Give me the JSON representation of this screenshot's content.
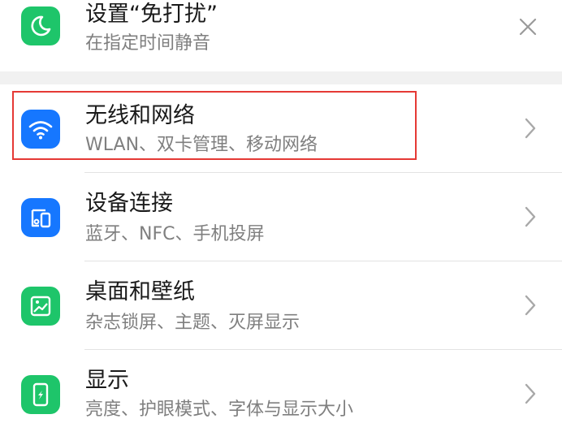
{
  "colors": {
    "wifi_icon_bg": "#1677ff",
    "device_icon_bg": "#1677ff",
    "green_icon_bg": "#1ec56a",
    "highlight_border": "#e53935"
  },
  "dnd_card": {
    "title": "设置“免打扰”",
    "subtitle": "在指定时间静音",
    "icon": "moon-icon",
    "close_icon": "close-icon"
  },
  "settings": [
    {
      "title": "无线和网络",
      "subtitle": "WLAN、双卡管理、移动网络",
      "icon": "wifi-icon"
    },
    {
      "title": "设备连接",
      "subtitle": "蓝牙、NFC、手机投屏",
      "icon": "device-connection-icon"
    },
    {
      "title": "桌面和壁纸",
      "subtitle": "杂志锁屏、主题、灭屏显示",
      "icon": "wallpaper-icon"
    },
    {
      "title": "显示",
      "subtitle": "亮度、护眼模式、字体与显示大小",
      "icon": "display-icon"
    }
  ]
}
